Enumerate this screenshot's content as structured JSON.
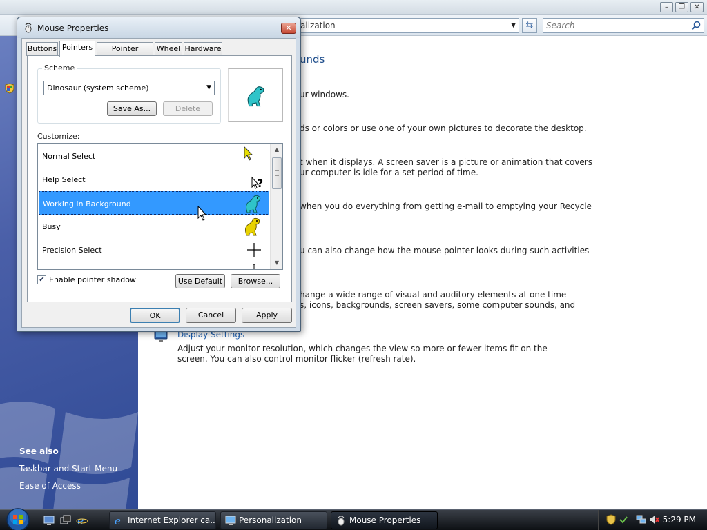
{
  "control_panel": {
    "address_text": "alization",
    "search_placeholder": "Search",
    "heading": "unds",
    "content_lines": [
      "ur windows.",
      "ds or colors or use one of your own pictures to decorate the desktop.",
      "t when it displays. A screen saver is a picture or animation that covers",
      "ur computer is idle for a set period of time.",
      "when you do everything from getting e-mail to emptying your Recycle",
      "u can also change how the mouse pointer looks during such activities",
      "hange a wide range of visual and auditory elements at one time",
      "s, icons, backgrounds, screen savers, some computer sounds, and"
    ],
    "display_settings": {
      "title": "Display Settings",
      "description": "Adjust your monitor resolution, which changes the view so more or fewer items fit on the screen. You can also control monitor flicker (refresh rate)."
    },
    "sidebar": {
      "see_also": "See also",
      "links": [
        "Taskbar and Start Menu",
        "Ease of Access"
      ]
    }
  },
  "dialog": {
    "title": "Mouse Properties",
    "tabs": [
      "Buttons",
      "Pointers",
      "Pointer Options",
      "Wheel",
      "Hardware"
    ],
    "active_tab": "Pointers",
    "scheme": {
      "label": "Scheme",
      "selected": "Dinosaur (system scheme)",
      "save_as": "Save As...",
      "delete": "Delete"
    },
    "customize_label": "Customize:",
    "cursors": [
      {
        "label": "Normal Select",
        "icon": "arrow-cursor-icon"
      },
      {
        "label": "Help Select",
        "icon": "help-cursor-icon"
      },
      {
        "label": "Working In Background",
        "icon": "dinosaur-cursor-icon"
      },
      {
        "label": "Busy",
        "icon": "yellow-dinosaur-icon"
      },
      {
        "label": "Precision Select",
        "icon": "crosshair-icon"
      }
    ],
    "selected_cursor": "Working In Background",
    "enable_shadow_label": "Enable pointer shadow",
    "enable_shadow_checked": true,
    "use_default": "Use Default",
    "browse": "Browse...",
    "ok": "OK",
    "cancel": "Cancel",
    "apply": "Apply"
  },
  "taskbar": {
    "tasks": [
      {
        "label": "Internet Explorer ca...",
        "icon": "ie-icon"
      },
      {
        "label": "Personalization",
        "icon": "control-panel-icon"
      },
      {
        "label": "Mouse Properties",
        "icon": "mouse-icon"
      }
    ],
    "active_task": "Mouse Properties",
    "clock": "5:29 PM"
  },
  "colors": {
    "selection": "#3399ff",
    "link": "#1d5fb0",
    "dino_teal": "#2fc4c9",
    "dino_yellow": "#e8d200"
  }
}
